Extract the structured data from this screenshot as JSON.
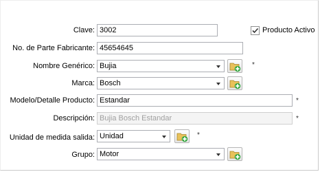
{
  "form": {
    "clave_label": "Clave:",
    "clave_value": "3002",
    "parte_label": "No. de Parte Fabricante:",
    "parte_value": "45654645",
    "generico_label": "Nombre Genérico:",
    "generico_value": "Bujia",
    "marca_label": "Marca:",
    "marca_value": "Bosch",
    "modelo_label": "Modelo/Detalle Producto:",
    "modelo_value": "Estandar",
    "descripcion_label": "Descripción:",
    "descripcion_value": "Bujia Bosch Estandar",
    "unidad_label": "Unidad de medida salida:",
    "unidad_value": "Unidad",
    "grupo_label": "Grupo:",
    "grupo_value": "Motor",
    "activo_label": "Producto Activo",
    "activo_checked": true,
    "required_mark": "*"
  },
  "icons": {
    "add": "folder-add-icon",
    "dropdown": "chevron-down-icon",
    "check": "checkmark-icon"
  },
  "colors": {
    "folder": "#e8c15a",
    "plus": "#3aa845"
  }
}
